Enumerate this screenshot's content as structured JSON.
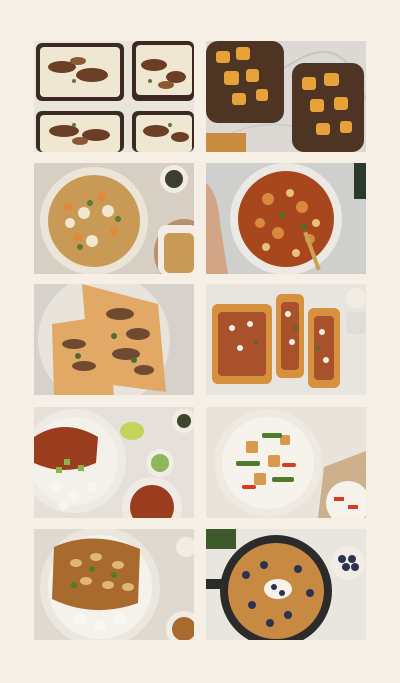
{
  "collage": {
    "tiles": [
      {
        "icon": "mushroom-toast-photo"
      },
      {
        "icon": "sweet-potato-toast-photo"
      },
      {
        "icon": "vegetable-soup-photo"
      },
      {
        "icon": "pasta-stew-photo"
      },
      {
        "icon": "mushroom-flatbread-photo"
      },
      {
        "icon": "vegetable-tart-photo"
      },
      {
        "icon": "chili-rice-bowl-photo"
      },
      {
        "icon": "tofu-stir-fry-photo"
      },
      {
        "icon": "bean-curry-rice-photo"
      },
      {
        "icon": "blueberry-pancake-photo"
      }
    ]
  },
  "colors": {
    "background": "#f5efe6",
    "marble": "#d9d6d2",
    "plate": "#e7e2da",
    "sauce": "#a8471e"
  }
}
